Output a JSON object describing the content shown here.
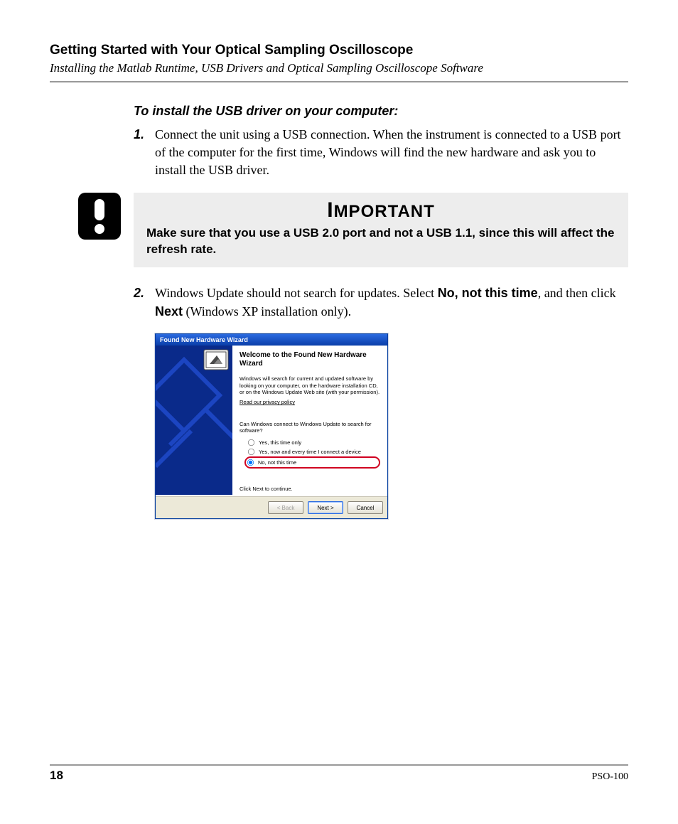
{
  "header": {
    "chapter_title": "Getting Started with Your Optical Sampling Oscilloscope",
    "section_subtitle": "Installing the Matlab Runtime, USB Drivers and Optical Sampling Oscilloscope Software"
  },
  "procedure": {
    "title": "To install the USB driver on your computer:",
    "step1_num": "1.",
    "step1_text": "Connect the unit using a USB connection. When the instrument is connected to a USB port of the computer for the first time, Windows will find the new hardware and ask you to install the USB driver.",
    "step2_num": "2.",
    "step2_a": "Windows Update should not search for updates. Select ",
    "step2_bold1": "No, not this time",
    "step2_b": ", and then click ",
    "step2_bold2": "Next",
    "step2_c": " (Windows XP installation only)."
  },
  "important": {
    "title": "IMPORTANT",
    "text": "Make sure that you use a USB 2.0 port and not a USB 1.1, since this will affect the refresh rate."
  },
  "wizard": {
    "titlebar": "Found New Hardware Wizard",
    "heading": "Welcome to the Found New Hardware Wizard",
    "intro": "Windows will search for current and updated software by looking on your computer, on the hardware installation CD, or on the Windows Update Web site (with your permission).",
    "link": "Read our privacy policy",
    "question": "Can Windows connect to Windows Update to search for software?",
    "opt1": "Yes, this time only",
    "opt2": "Yes, now and every time I connect a device",
    "opt3": "No, not this time",
    "continue": "Click Next to continue.",
    "btn_back": "< Back",
    "btn_next": "Next >",
    "btn_cancel": "Cancel"
  },
  "footer": {
    "page_number": "18",
    "doc_id": "PSO-100"
  }
}
